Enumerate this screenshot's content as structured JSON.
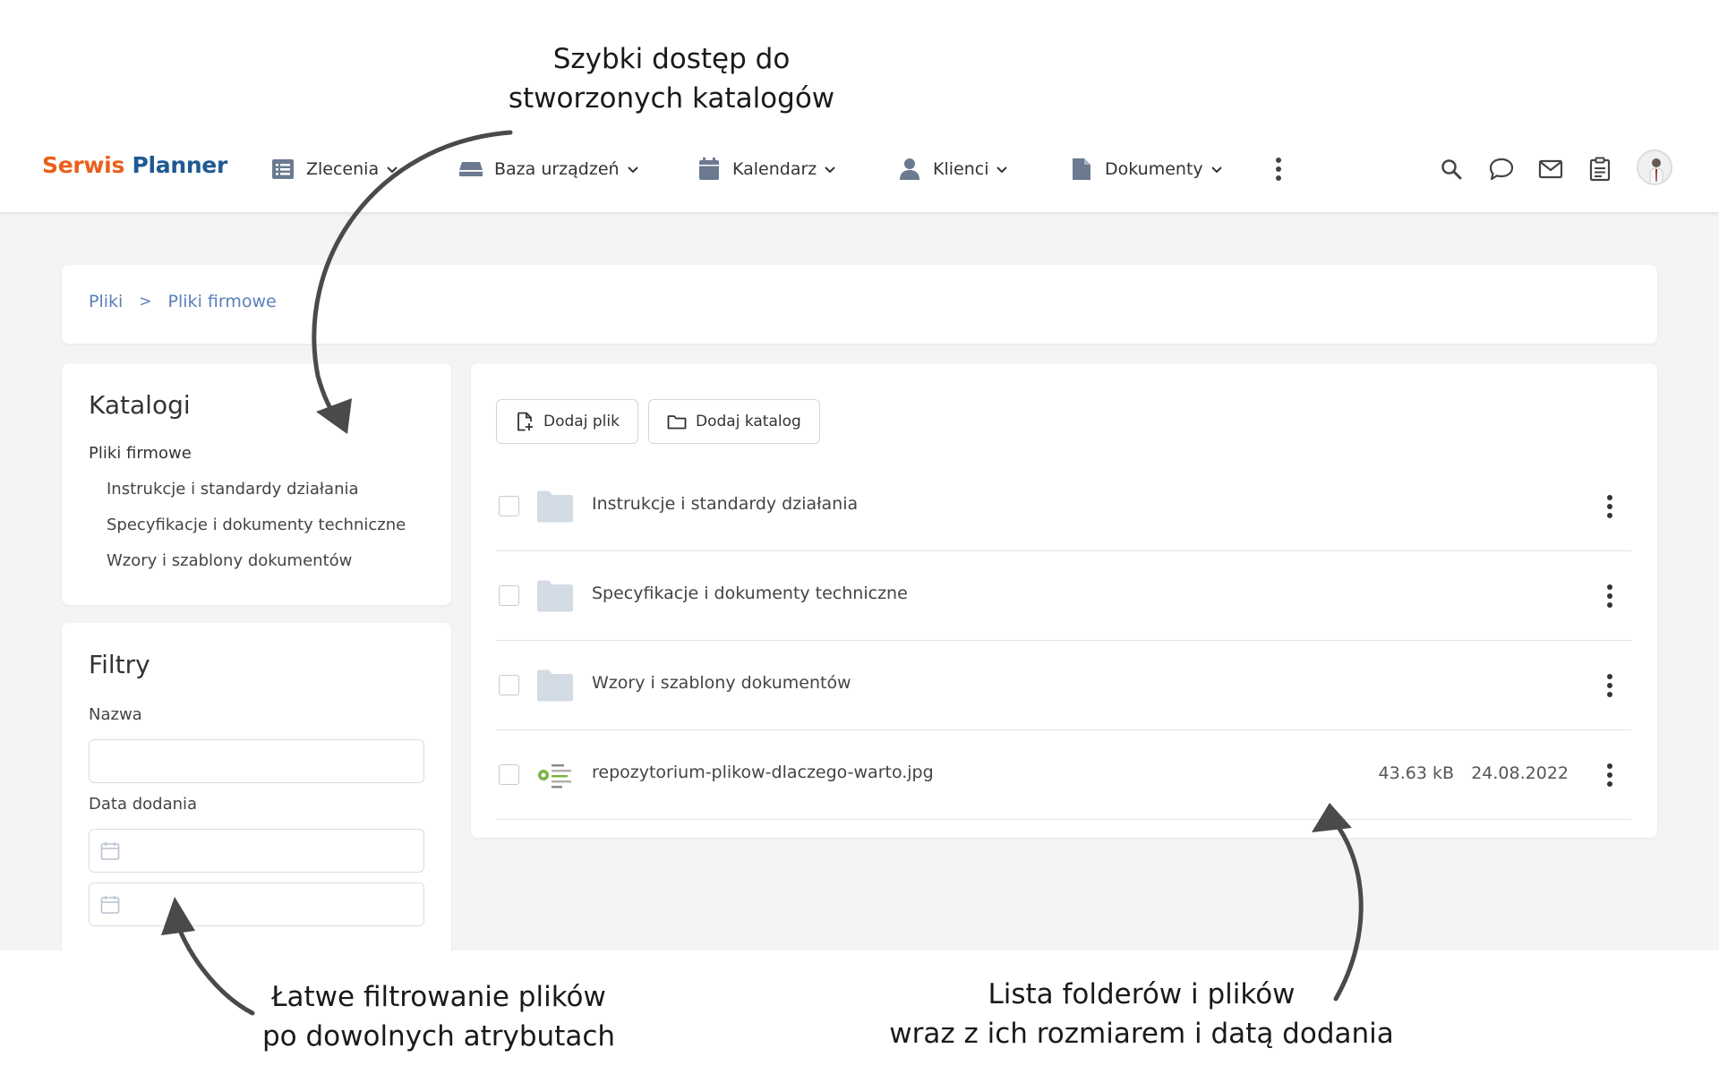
{
  "annotations": {
    "top": [
      "Szybki dostęp do",
      "stworzonych katalogów"
    ],
    "left": [
      "Łatwe filtrowanie plików",
      "po dowolnych atrybutach"
    ],
    "right": [
      "Lista folderów i plików",
      "wraz z ich rozmiarem i datą dodania"
    ]
  },
  "app": {
    "logo": {
      "part1": "Serwis",
      "part2": "Planner"
    },
    "nav": [
      {
        "label": "Zlecenia",
        "icon": "list-icon"
      },
      {
        "label": "Baza urządzeń",
        "icon": "drive-icon"
      },
      {
        "label": "Kalendarz",
        "icon": "calendar-icon"
      },
      {
        "label": "Klienci",
        "icon": "person-icon"
      },
      {
        "label": "Dokumenty",
        "icon": "document-icon"
      }
    ],
    "right_icons": [
      "search-icon",
      "chat-icon",
      "mail-icon",
      "clipboard-icon"
    ]
  },
  "breadcrumb": {
    "items": [
      "Pliki",
      "Pliki firmowe"
    ],
    "separator": ">"
  },
  "catalogs": {
    "title": "Katalogi",
    "root": "Pliki firmowe",
    "children": [
      "Instrukcje i standardy działania",
      "Specyfikacje i dokumenty techniczne",
      "Wzory i szablony dokumentów"
    ]
  },
  "filters": {
    "title": "Filtry",
    "name_label": "Nazwa",
    "name_value": "",
    "date_label": "Data dodania",
    "date_from": "",
    "date_to": ""
  },
  "files": {
    "buttons": {
      "add_file": "Dodaj plik",
      "add_folder": "Dodaj katalog"
    },
    "rows": [
      {
        "type": "folder",
        "name": "Instrukcje i standardy działania",
        "size": "",
        "date": ""
      },
      {
        "type": "folder",
        "name": "Specyfikacje i dokumenty techniczne",
        "size": "",
        "date": ""
      },
      {
        "type": "folder",
        "name": "Wzory i szablony dokumentów",
        "size": "",
        "date": ""
      },
      {
        "type": "image",
        "name": "repozytorium-plikow-dlaczego-warto.jpg",
        "size": "43.63 kB",
        "date": "24.08.2022"
      }
    ]
  },
  "colors": {
    "logo_orange": "#e8601c",
    "logo_blue": "#1f5a93",
    "link_blue": "#5a80b8",
    "background": "#f4f4f4",
    "nav_icon": "#6b7a90",
    "folder": "#d3dbe5"
  }
}
